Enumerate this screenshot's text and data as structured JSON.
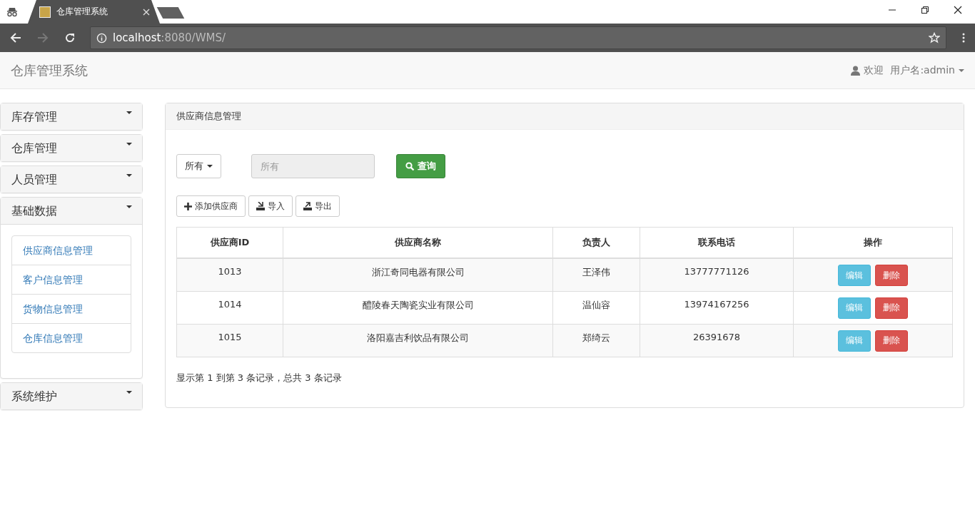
{
  "browser": {
    "tab_title": "仓库管理系统",
    "url_host": "localhost",
    "url_path": ":8080/WMS/"
  },
  "navbar": {
    "brand": "仓库管理系统",
    "welcome": "欢迎",
    "user": "用户名:admin"
  },
  "sidebar": {
    "sections": [
      {
        "title": "库存管理",
        "expanded": false
      },
      {
        "title": "仓库管理",
        "expanded": false
      },
      {
        "title": "人员管理",
        "expanded": false
      },
      {
        "title": "基础数据",
        "expanded": true,
        "items": [
          "供应商信息管理",
          "客户信息管理",
          "货物信息管理",
          "仓库信息管理"
        ]
      },
      {
        "title": "系统维护",
        "expanded": false
      }
    ]
  },
  "panel": {
    "title": "供应商信息管理",
    "filter": {
      "dropdown": "所有",
      "placeholder": "所有",
      "search_button": "查询"
    },
    "actions": [
      {
        "kind": "add",
        "label": "添加供应商"
      },
      {
        "kind": "import",
        "label": "导入"
      },
      {
        "kind": "export",
        "label": "导出"
      }
    ],
    "table": {
      "columns": [
        "供应商ID",
        "供应商名称",
        "负责人",
        "联系电话",
        "操作"
      ],
      "rows": [
        {
          "id": "1013",
          "name": "浙江奇同电器有限公司",
          "contact": "王泽伟",
          "phone": "13777771126",
          "edit": "编辑",
          "delete": "删除"
        },
        {
          "id": "1014",
          "name": "醴陵春天陶瓷实业有限公司",
          "contact": "温仙容",
          "phone": "13974167256",
          "edit": "编辑",
          "delete": "删除"
        },
        {
          "id": "1015",
          "name": "洛阳嘉吉利饮品有限公司",
          "contact": "郑绮云",
          "phone": "26391678",
          "edit": "编辑",
          "delete": "删除"
        }
      ]
    },
    "footer": "显示第 1 到第 3 条记录，总共 3 条记录"
  }
}
